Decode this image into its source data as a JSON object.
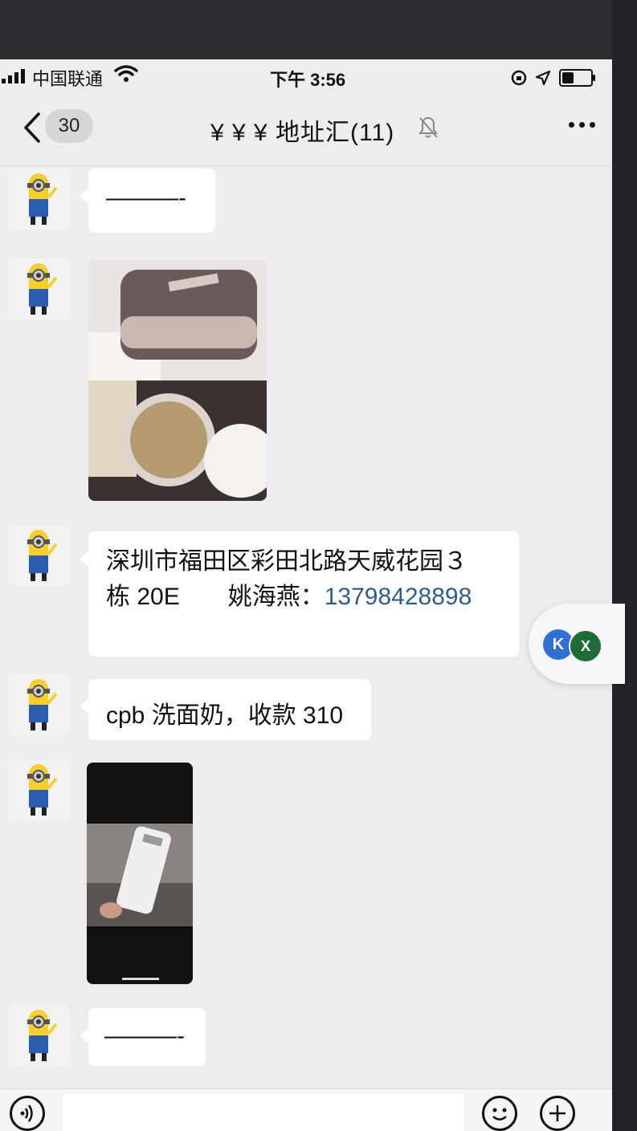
{
  "status_bar": {
    "carrier": "中国联通",
    "time": "下午 3:56"
  },
  "nav": {
    "unread_count": "30",
    "title": "¥ ¥ ¥ 地址汇(11)"
  },
  "messages": [
    {
      "type": "text",
      "text": "———-"
    },
    {
      "type": "image",
      "icon": "cushion-compact-photo"
    },
    {
      "type": "text",
      "line1": "深圳市福田区彩田北路天威花园３",
      "line2_prefix": "栋 20E　　姚海燕：",
      "phone": "13798428898"
    },
    {
      "type": "text",
      "text": "cpb 洗面奶，收款 310"
    },
    {
      "type": "image",
      "icon": "cleanser-tube-photo"
    },
    {
      "type": "text",
      "text": "———-"
    }
  ],
  "floating_window": {
    "badge_a": "K",
    "badge_b": "X"
  },
  "colors": {
    "background": "#ededed",
    "bubble": "#ffffff",
    "link": "#2f5e8c"
  }
}
